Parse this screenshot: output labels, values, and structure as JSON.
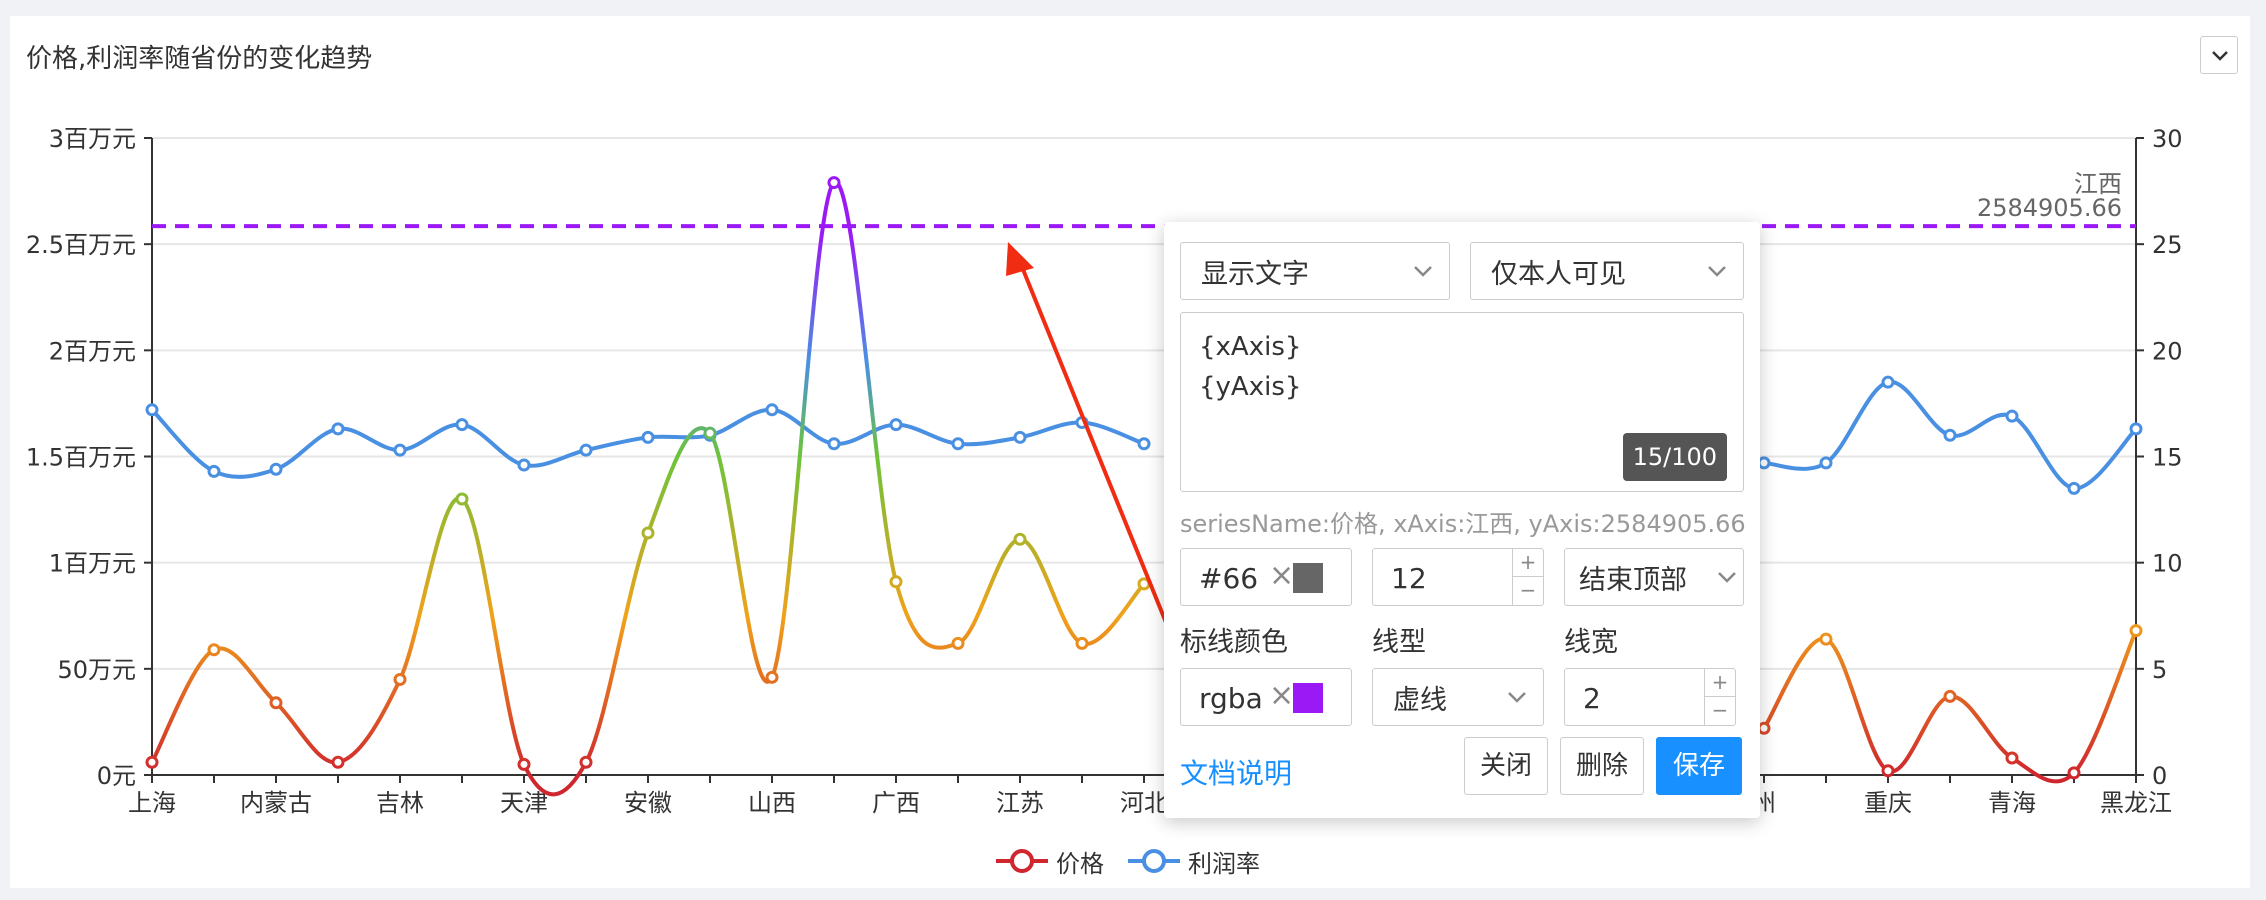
{
  "card": {
    "title": "价格,利润率随省份的变化趋势"
  },
  "legend": [
    {
      "label": "价格",
      "color": "#d0262d"
    },
    {
      "label": "利润率",
      "color": "#4a90e2"
    }
  ],
  "markline": {
    "label_line1": "江西",
    "label_line2": "2584905.66",
    "color": "#9b19f5"
  },
  "popup": {
    "select_display": "显示文字",
    "select_visibility": "仅本人可见",
    "template_lines": [
      "{xAxis}",
      "{yAxis}"
    ],
    "char_counter": "15/100",
    "info_text": "seriesName:价格, xAxis:江西, yAxis:2584905.66",
    "font_color_value": "#66",
    "font_color_swatch": "#666666",
    "font_size_value": "12",
    "position_select": "结束顶部",
    "label_line_color": "标线颜色",
    "label_line_type": "线型",
    "label_line_width": "线宽",
    "line_color_value": "rgba",
    "line_color_swatch": "#9b19f5",
    "line_type_select": "虚线",
    "line_width_value": "2",
    "doc_link": "文档说明",
    "btn_close": "关闭",
    "btn_delete": "删除",
    "btn_save": "保存"
  },
  "chart_data": {
    "type": "line",
    "title": "价格,利润率随省份的变化趋势",
    "categories": [
      "上海",
      "",
      "内蒙古",
      "",
      "吉林",
      "",
      "天津",
      "",
      "安徽",
      "",
      "山西",
      "",
      "广西",
      "",
      "江苏",
      "",
      "河北",
      "",
      "",
      "",
      "",
      "",
      "",
      "",
      "",
      "",
      "",
      "",
      "",
      "",
      "",
      "",
      "",
      "",
      "",
      "",
      "",
      "",
      "",
      "",
      "",
      "",
      "",
      "",
      "",
      "",
      "",
      "",
      "",
      "",
      "",
      "",
      "",
      "",
      "",
      "",
      "",
      "",
      "",
      "",
      "",
      "",
      "",
      "",
      "",
      "",
      "",
      "",
      ""
    ],
    "x_visible_labels": [
      "上海",
      "内蒙古",
      "吉林",
      "天津",
      "安徽",
      "山西",
      "广西",
      "江苏",
      "河北",
      "州",
      "重庆",
      "青海",
      "黑龙江"
    ],
    "y_left_ticks": [
      "0元",
      "50万元",
      "1百万元",
      "1.5百万元",
      "2百万元",
      "2.5百万元",
      "3百万元"
    ],
    "y_right_ticks": [
      "0",
      "5",
      "10",
      "15",
      "20",
      "25",
      "30"
    ],
    "ylim_left": [
      0,
      3000000
    ],
    "ylim_right": [
      0,
      30
    ],
    "markline_value": 2584905.66,
    "series": [
      {
        "name": "价格",
        "axis": "left",
        "x": [
          0,
          1,
          2,
          3,
          4,
          5,
          6,
          7,
          8,
          9,
          10,
          11,
          12,
          13,
          14,
          15,
          16,
          26,
          27,
          28,
          29,
          30,
          31,
          32
        ],
        "values": [
          60000,
          590000,
          340000,
          60000,
          450000,
          1300000,
          50000,
          60000,
          1140000,
          1610000,
          460000,
          2790000,
          910000,
          620000,
          1110000,
          620000,
          900000,
          220000,
          640000,
          20000,
          370000,
          80000,
          10000,
          680000
        ]
      },
      {
        "name": "利润率",
        "axis": "right",
        "x": [
          0,
          1,
          2,
          3,
          4,
          5,
          6,
          7,
          8,
          9,
          10,
          11,
          12,
          13,
          14,
          15,
          16,
          26,
          27,
          28,
          29,
          30,
          31,
          32
        ],
        "values": [
          17.2,
          14.3,
          14.4,
          16.3,
          15.3,
          16.5,
          14.6,
          15.3,
          15.9,
          16.0,
          17.2,
          15.6,
          16.5,
          15.6,
          15.9,
          16.6,
          15.6,
          14.7,
          14.7,
          18.5,
          16.0,
          16.9,
          13.5,
          16.3
        ]
      }
    ]
  }
}
